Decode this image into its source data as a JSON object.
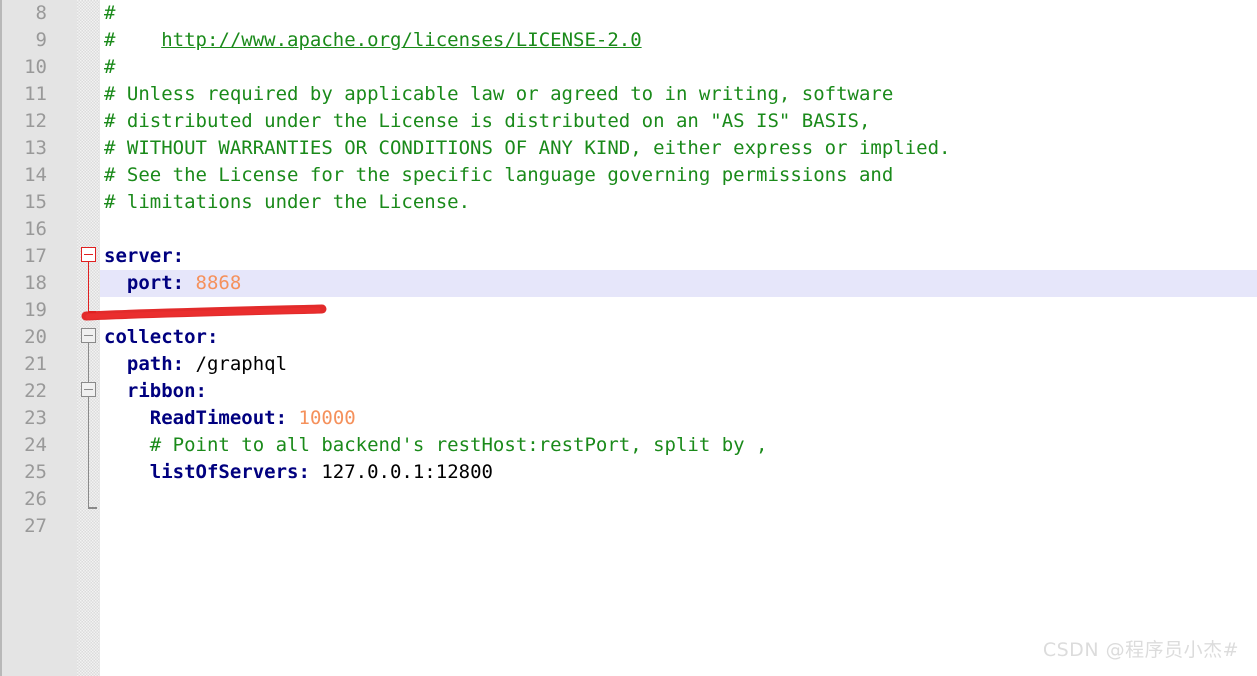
{
  "editor": {
    "file_type": "yaml",
    "first_line_number": 8,
    "highlighted_line_number": 18,
    "colors": {
      "comment": "#1a8a1a",
      "key": "#00007f",
      "number": "#f5915c",
      "text": "#000000",
      "line_highlight": "#e6e6fa",
      "gutter": "#e4e4e4",
      "line_number": "#999999",
      "annotation": "#e02020"
    },
    "line_numbers": [
      "8",
      "9",
      "10",
      "11",
      "12",
      "13",
      "14",
      "15",
      "16",
      "17",
      "18",
      "19",
      "20",
      "21",
      "22",
      "23",
      "24",
      "25",
      "26",
      "27"
    ],
    "lines": [
      {
        "num": "8",
        "tokens": [
          {
            "t": "comment",
            "v": "#"
          }
        ]
      },
      {
        "num": "9",
        "tokens": [
          {
            "t": "comment",
            "v": "#    "
          },
          {
            "t": "link",
            "v": "http://www.apache.org/licenses/LICENSE-2.0"
          }
        ]
      },
      {
        "num": "10",
        "tokens": [
          {
            "t": "comment",
            "v": "#"
          }
        ]
      },
      {
        "num": "11",
        "tokens": [
          {
            "t": "comment",
            "v": "# Unless required by applicable law or agreed to in writing, software"
          }
        ]
      },
      {
        "num": "12",
        "tokens": [
          {
            "t": "comment",
            "v": "# distributed under the License is distributed on an \"AS IS\" BASIS,"
          }
        ]
      },
      {
        "num": "13",
        "tokens": [
          {
            "t": "comment",
            "v": "# WITHOUT WARRANTIES OR CONDITIONS OF ANY KIND, either express or implied."
          }
        ]
      },
      {
        "num": "14",
        "tokens": [
          {
            "t": "comment",
            "v": "# See the License for the specific language governing permissions and"
          }
        ]
      },
      {
        "num": "15",
        "tokens": [
          {
            "t": "comment",
            "v": "# limitations under the License."
          }
        ]
      },
      {
        "num": "16",
        "tokens": []
      },
      {
        "num": "17",
        "tokens": [
          {
            "t": "key",
            "v": "server"
          },
          {
            "t": "punct",
            "v": ":"
          }
        ]
      },
      {
        "num": "18",
        "tokens": [
          {
            "t": "key",
            "v": "  port"
          },
          {
            "t": "punct",
            "v": ":"
          },
          {
            "t": "text",
            "v": " "
          },
          {
            "t": "number",
            "v": "8868"
          }
        ]
      },
      {
        "num": "19",
        "tokens": []
      },
      {
        "num": "20",
        "tokens": [
          {
            "t": "key",
            "v": "collector"
          },
          {
            "t": "punct",
            "v": ":"
          }
        ]
      },
      {
        "num": "21",
        "tokens": [
          {
            "t": "key",
            "v": "  path"
          },
          {
            "t": "punct",
            "v": ":"
          },
          {
            "t": "text",
            "v": " /graphql"
          }
        ]
      },
      {
        "num": "22",
        "tokens": [
          {
            "t": "key",
            "v": "  ribbon"
          },
          {
            "t": "punct",
            "v": ":"
          }
        ]
      },
      {
        "num": "23",
        "tokens": [
          {
            "t": "key",
            "v": "    ReadTimeout"
          },
          {
            "t": "punct",
            "v": ":"
          },
          {
            "t": "text",
            "v": " "
          },
          {
            "t": "number",
            "v": "10000"
          }
        ]
      },
      {
        "num": "24",
        "tokens": [
          {
            "t": "text",
            "v": "    "
          },
          {
            "t": "comment",
            "v": "# Point to all backend's restHost:restPort, split by ,"
          }
        ]
      },
      {
        "num": "25",
        "tokens": [
          {
            "t": "key",
            "v": "    listOfServers"
          },
          {
            "t": "punct",
            "v": ":"
          },
          {
            "t": "text",
            "v": " 127.0.0.1:12800"
          }
        ]
      },
      {
        "num": "26",
        "tokens": []
      },
      {
        "num": "27",
        "tokens": []
      }
    ],
    "fold_markers": [
      {
        "name": "fold-marker-server",
        "line": "17",
        "state": "expanded",
        "color": "red"
      },
      {
        "name": "fold-marker-collector",
        "line": "20",
        "state": "expanded",
        "color": "gray"
      },
      {
        "name": "fold-marker-ribbon",
        "line": "22",
        "state": "expanded",
        "color": "gray"
      }
    ],
    "annotation": {
      "type": "freehand-underline",
      "color": "#e02020",
      "description": "red hand-drawn underline beneath the server port line"
    }
  },
  "watermark": {
    "text": "CSDN @程序员小杰#"
  }
}
